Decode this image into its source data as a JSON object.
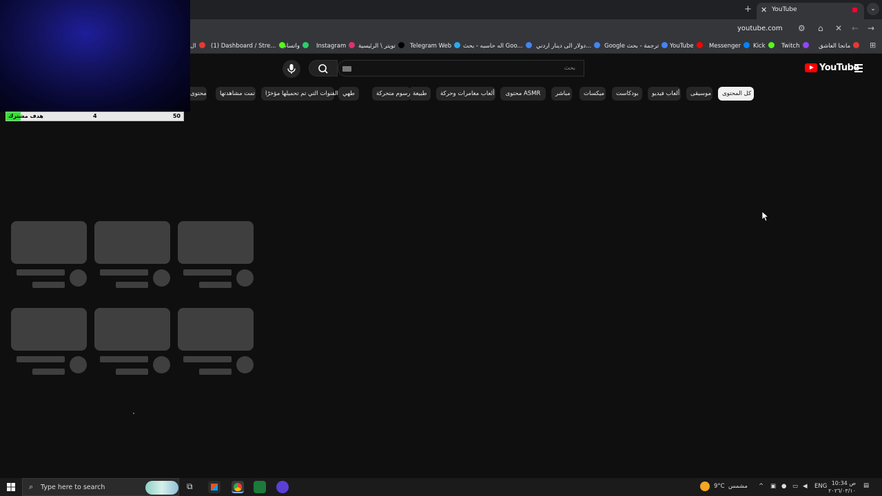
{
  "browser": {
    "tab_title": "YouTube",
    "new_tab": "+",
    "close_glyph": "✕",
    "url": "youtube.com",
    "bookmarks": [
      {
        "label": "مانجا العاشق",
        "color": "#e53935"
      },
      {
        "label": "Twitch",
        "color": "#9146ff"
      },
      {
        "label": "Kick",
        "color": "#53fc18"
      },
      {
        "label": "Messenger",
        "color": "#0084ff"
      },
      {
        "label": "YouTube",
        "color": "#ff0000"
      },
      {
        "label": "Google ترجمة - بحث",
        "color": "#4285f4"
      },
      {
        "label": "دولار الى دينار اردني...",
        "color": "#4285f4"
      },
      {
        "label": "اله حاسبه - بحث Goo...",
        "color": "#4285f4"
      },
      {
        "label": "Telegram Web",
        "color": "#2aabee"
      },
      {
        "label": "تويتر \\ الرئيسية",
        "color": "#000000"
      },
      {
        "label": "Instagram",
        "color": "#e1306c"
      },
      {
        "label": "واتساب",
        "color": "#25d366"
      },
      {
        "label": "(1) Dashboard / Stre...",
        "color": "#53fc18"
      },
      {
        "label": "ال",
        "color": "#e53935"
      }
    ]
  },
  "youtube": {
    "logo_text": "YouTube",
    "search_placeholder": "بحث",
    "chips": [
      "كل المحتوى",
      "موسيقى",
      "ألعاب فيديو",
      "بودكاست",
      "ميكسات",
      "مباشر",
      "محتوى ASMR",
      "ألعاب مغامرات وحركة",
      "طبيعة",
      "رسوم متحركة",
      "طهي",
      "الفنوات التي تم تحميلها مؤخرًا",
      "تمت مشاهدتها",
      "محتوى"
    ]
  },
  "overlay": {
    "goal_label": "هدف مشترك",
    "current": "4",
    "target": "50",
    "progress_fraction": 0.08
  },
  "taskbar": {
    "search_placeholder": "Type here to search",
    "weather_temp": "9°C",
    "weather_text": "مشمس",
    "language": "ENG",
    "time": "10:34 ص",
    "date": "٢٠٢٦/٠٣/١٠"
  }
}
